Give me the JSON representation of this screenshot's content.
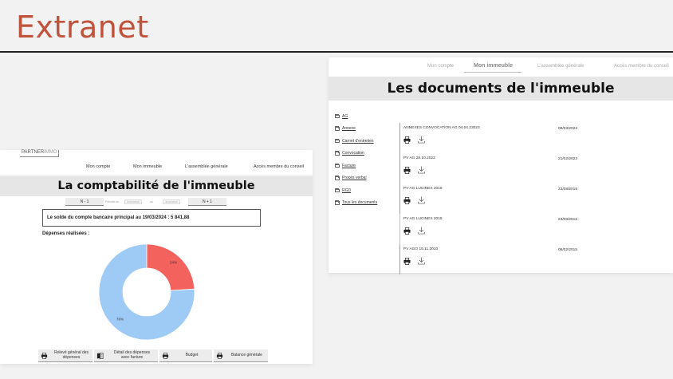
{
  "slide": {
    "title": "Extranet"
  },
  "documents_screen": {
    "nav": [
      {
        "label": "Mon compte",
        "active": false
      },
      {
        "label": "Mon immeuble",
        "active": true
      },
      {
        "label": "L'assemblée générale",
        "active": false
      },
      {
        "label": "Accès membre du conseil",
        "active": false
      }
    ],
    "title": "Les documents de l'immeuble",
    "folders": [
      "AG",
      "Annexe",
      "Carnet d'entretien",
      "Convocation",
      "Facture",
      "Procès verbal",
      "RGD",
      "Tous les documents"
    ],
    "documents": [
      {
        "name": "ANNEXES CONVOCATION AG 04.04.23023",
        "date": "09/03/2023"
      },
      {
        "name": "PV AG 28.10.2022",
        "date": "21/02/2023"
      },
      {
        "name": "PV AG LUCINES 2016",
        "date": "23/08/2016"
      },
      {
        "name": "PV AG LUCINES 2015",
        "date": "23/08/2016"
      },
      {
        "name": "PV AGO 15.11.2010",
        "date": "05/02/2015"
      }
    ],
    "icons": {
      "print": "printer-icon",
      "download": "download-icon",
      "folder": "folder-icon"
    }
  },
  "accounting_screen": {
    "logo": {
      "part1": "PARTNER",
      "part2": "IMMO"
    },
    "nav": [
      "Mon compte",
      "Mon immeuble",
      "L'assemblée générale",
      "Accès membre du conseil"
    ],
    "title": "La comptabilité de l'immeuble",
    "year_selector": {
      "prev": "N - 1",
      "next": "N + 1",
      "from_label": "Période du",
      "from_value": "01/01/2022",
      "to_label": "au",
      "to_value": "31/12/2023"
    },
    "balance": "Le solde du compte bancaire principal au 19/03/2024 : 5 841,88",
    "expenses_label": "Dépenses réalisées :",
    "buttons": [
      {
        "label": "Relevé général des\ndépenses",
        "icon": "printer-icon"
      },
      {
        "label": "Détail des dépenses\navec facture",
        "icon": "pdf-icon"
      },
      {
        "label": "Budget",
        "icon": "printer-icon"
      },
      {
        "label": "Balance générale",
        "icon": "printer-icon"
      }
    ]
  },
  "chart_data": {
    "type": "pie",
    "donut": true,
    "categories": [
      "",
      ""
    ],
    "values": [
      24,
      76
    ],
    "labels": [
      "24%",
      "76%"
    ],
    "colors": [
      "#f4625e",
      "#9ecbf5"
    ]
  }
}
